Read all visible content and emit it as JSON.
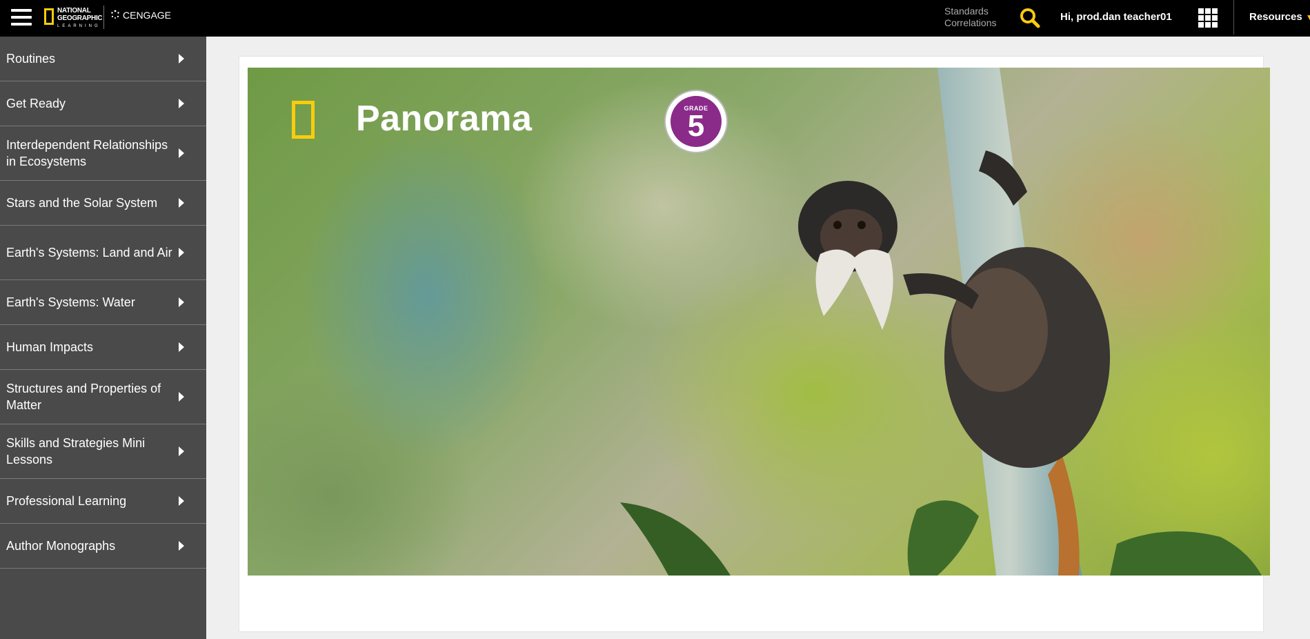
{
  "header": {
    "brand": {
      "line1": "NATIONAL",
      "line2": "GEOGRAPHIC",
      "line3": "LEARNING",
      "partner": "CENGAGE"
    },
    "standards_line1": "Standards",
    "standards_line2": "Correlations",
    "greeting": "Hi, prod.dan teacher01",
    "resources_label": "Resources",
    "icons": [
      "hamburger-menu-icon",
      "search-icon",
      "apps-grid-icon",
      "chevron-down-icon"
    ],
    "accent_color": "#f9cc0d"
  },
  "sidebar": {
    "items": [
      {
        "label": "Routines"
      },
      {
        "label": "Get Ready"
      },
      {
        "label": "Interdependent Relationships in Ecosystems"
      },
      {
        "label": "Stars and the Solar System"
      },
      {
        "label": "Earth's Systems: Land and Air"
      },
      {
        "label": "Earth's Systems: Water"
      },
      {
        "label": "Human Impacts"
      },
      {
        "label": "Structures and Properties of Matter"
      },
      {
        "label": "Skills and Strategies Mini Lessons"
      },
      {
        "label": "Professional Learning"
      },
      {
        "label": "Author Monographs"
      }
    ]
  },
  "hero": {
    "title": "Panorama",
    "grade_label": "GRADE",
    "grade_number": "5",
    "badge_color": "#8a2b8a"
  }
}
